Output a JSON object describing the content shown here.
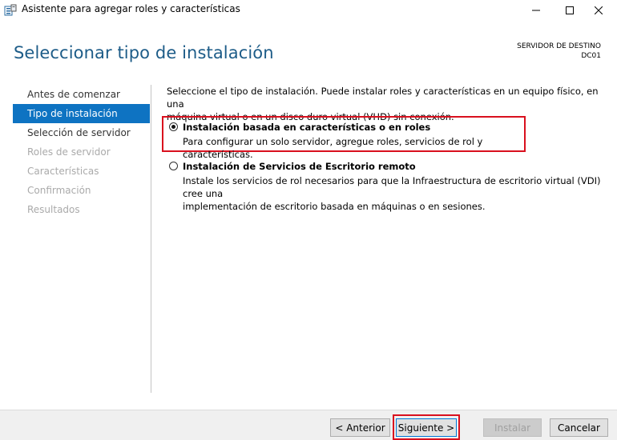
{
  "window": {
    "title": "Asistente para agregar roles y características",
    "icon": "server-manager-icon"
  },
  "header": {
    "title": "Seleccionar tipo de instalación",
    "destination_label": "SERVIDOR DE DESTINO",
    "destination_server": "DC01"
  },
  "sidebar": {
    "items": [
      {
        "label": "Antes de comenzar",
        "state": "normal"
      },
      {
        "label": "Tipo de instalación",
        "state": "active"
      },
      {
        "label": "Selección de servidor",
        "state": "normal"
      },
      {
        "label": "Roles de servidor",
        "state": "disabled"
      },
      {
        "label": "Características",
        "state": "disabled"
      },
      {
        "label": "Confirmación",
        "state": "disabled"
      },
      {
        "label": "Resultados",
        "state": "disabled"
      }
    ]
  },
  "content": {
    "intro_line1": "Seleccione el tipo de instalación. Puede instalar roles y características en un equipo físico, en una",
    "intro_line2": "máquina virtual o en un disco duro virtual (VHD) sin conexión.",
    "options": [
      {
        "title": "Instalación basada en características o en roles",
        "desc_lines": [
          "Para configurar un solo servidor, agregue roles, servicios de rol y características."
        ],
        "selected": true
      },
      {
        "title": "Instalación de Servicios de Escritorio remoto",
        "desc_lines": [
          "Instale los servicios de rol necesarios para que la Infraestructura de escritorio virtual (VDI) cree una",
          "implementación de escritorio basada en máquinas o en sesiones."
        ],
        "selected": false
      }
    ]
  },
  "footer": {
    "back_label": "< Anterior",
    "next_label": "Siguiente >",
    "install_label": "Instalar",
    "cancel_label": "Cancelar"
  },
  "colors": {
    "accent": "#0e73c2",
    "title_blue": "#1d5c88",
    "highlight_red": "#d9101e"
  }
}
